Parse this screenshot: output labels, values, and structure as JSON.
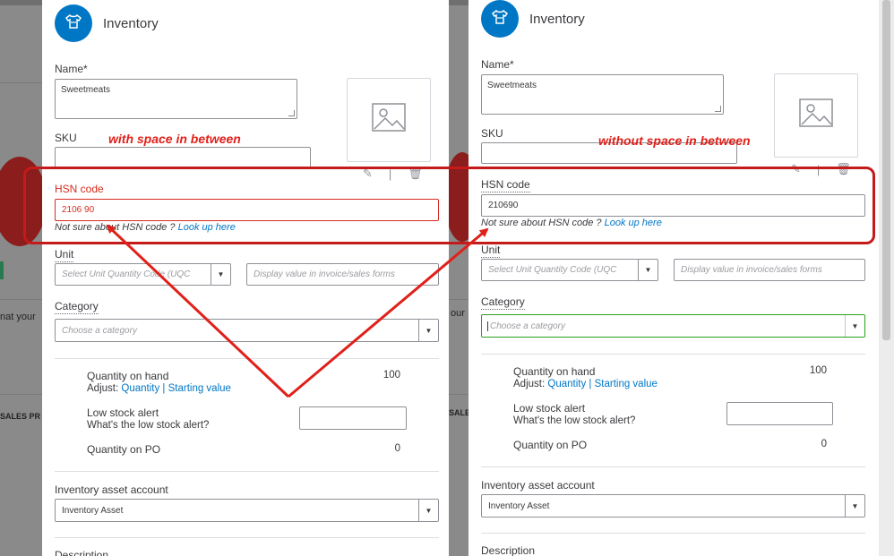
{
  "background": {
    "fragment_text_1": "nat your",
    "fragment_text_2": "SALES PR",
    "fragment_text_3": "our",
    "fragment_text_4": "SALES PR"
  },
  "annotations": {
    "left_caption": "with space in between",
    "right_caption": "without space in between",
    "color": "#e0201a"
  },
  "colors": {
    "brand_blue": "#0077c5",
    "error_red": "#d52b1e",
    "focus_green": "#2ca01c"
  },
  "left_panel": {
    "title": "Inventory",
    "logo_icon": "tshirt-icon",
    "name_label": "Name*",
    "name_value": "Sweetmeats",
    "sku_label": "SKU",
    "sku_value": "",
    "hsn_label": "HSN code",
    "hsn_value": "2106 90",
    "hsn_hint": "Not sure about HSN code ?",
    "hsn_link": "Look up here",
    "unit_label": "Unit",
    "unit_select_placeholder": "Select Unit Quantity Code (UQC",
    "unit_display_placeholder": "Display value in invoice/sales forms",
    "category_label": "Category",
    "category_placeholder": "Choose a category",
    "qty_on_hand_label": "Quantity on hand",
    "qty_on_hand_value": "100",
    "adjust_label": "Adjust:",
    "adjust_quantity_link": "Quantity",
    "adjust_separator": "|",
    "adjust_starting_link": "Starting value",
    "low_stock_label": "Low stock alert",
    "low_stock_link": "What's the low stock alert?",
    "low_stock_value": "",
    "qty_on_po_label": "Quantity on PO",
    "qty_on_po_value": "0",
    "asset_account_label": "Inventory asset account",
    "asset_account_value": "Inventory Asset",
    "description_label": "Description"
  },
  "right_panel": {
    "title": "Inventory",
    "logo_icon": "tshirt-icon",
    "name_label": "Name*",
    "name_value": "Sweetmeats",
    "sku_label": "SKU",
    "sku_value": "",
    "hsn_label": "HSN code",
    "hsn_value": "210690",
    "hsn_hint": "Not sure about HSN code ?",
    "hsn_link": "Look up here",
    "unit_label": "Unit",
    "unit_select_placeholder": "Select Unit Quantity Code (UQC",
    "unit_display_placeholder": "Display value in invoice/sales forms",
    "category_label": "Category",
    "category_placeholder": "Choose a category",
    "qty_on_hand_label": "Quantity on hand",
    "qty_on_hand_value": "100",
    "adjust_label": "Adjust:",
    "adjust_quantity_link": "Quantity",
    "adjust_separator": "|",
    "adjust_starting_link": "Starting value",
    "low_stock_label": "Low stock alert",
    "low_stock_link": "What's the low stock alert?",
    "low_stock_value": "",
    "qty_on_po_label": "Quantity on PO",
    "qty_on_po_value": "0",
    "asset_account_label": "Inventory asset account",
    "asset_account_value": "Inventory Asset",
    "description_label": "Description"
  }
}
